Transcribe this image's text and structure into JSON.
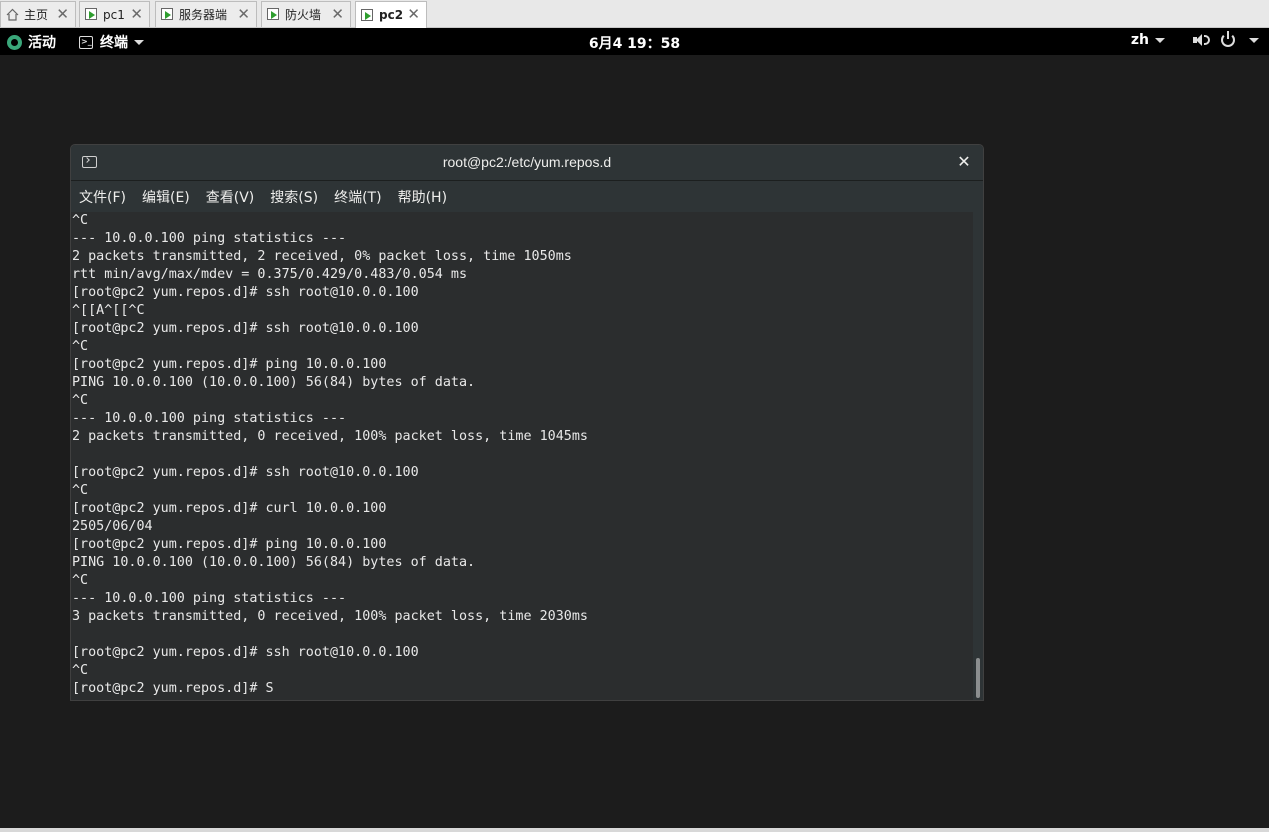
{
  "vm_tabs": [
    {
      "label": "主页",
      "icon": "home-icon",
      "active": false
    },
    {
      "label": "pc1",
      "icon": "vm-icon",
      "active": false
    },
    {
      "label": "服务器端",
      "icon": "vm-icon",
      "active": false
    },
    {
      "label": "防火墙",
      "icon": "vm-icon",
      "active": false
    },
    {
      "label": "pc2",
      "icon": "vm-icon",
      "active": true
    }
  ],
  "tab_close_glyph": "✕",
  "topbar": {
    "activities_label": "活动",
    "app_menu_label": "终端",
    "clock": "6月4  19：58",
    "language": "zh"
  },
  "window": {
    "title": "root@pc2:/etc/yum.repos.d",
    "close_glyph": "✕",
    "menu": [
      "文件(F)",
      "编辑(E)",
      "查看(V)",
      "搜索(S)",
      "终端(T)",
      "帮助(H)"
    ]
  },
  "terminal_lines": [
    "^C",
    "--- 10.0.0.100 ping statistics ---",
    "2 packets transmitted, 2 received, 0% packet loss, time 1050ms",
    "rtt min/avg/max/mdev = 0.375/0.429/0.483/0.054 ms",
    "[root@pc2 yum.repos.d]# ssh root@10.0.0.100",
    "^[[A^[[^C",
    "[root@pc2 yum.repos.d]# ssh root@10.0.0.100",
    "^C",
    "[root@pc2 yum.repos.d]# ping 10.0.0.100",
    "PING 10.0.0.100 (10.0.0.100) 56(84) bytes of data.",
    "^C",
    "--- 10.0.0.100 ping statistics ---",
    "2 packets transmitted, 0 received, 100% packet loss, time 1045ms",
    "",
    "[root@pc2 yum.repos.d]# ssh root@10.0.0.100",
    "^C",
    "[root@pc2 yum.repos.d]# curl 10.0.0.100",
    "2505/06/04",
    "[root@pc2 yum.repos.d]# ping 10.0.0.100",
    "PING 10.0.0.100 (10.0.0.100) 56(84) bytes of data.",
    "^C",
    "--- 10.0.0.100 ping statistics ---",
    "3 packets transmitted, 0 received, 100% packet loss, time 2030ms",
    "",
    "[root@pc2 yum.repos.d]# ssh root@10.0.0.100",
    "^C",
    "[root@pc2 yum.repos.d]# S"
  ],
  "colors": {
    "terminal_bg": "#2b2d2e",
    "terminal_fg": "#e8e8e8",
    "desktop_bg": "#1c1c1c",
    "topbar_bg": "#000000"
  }
}
